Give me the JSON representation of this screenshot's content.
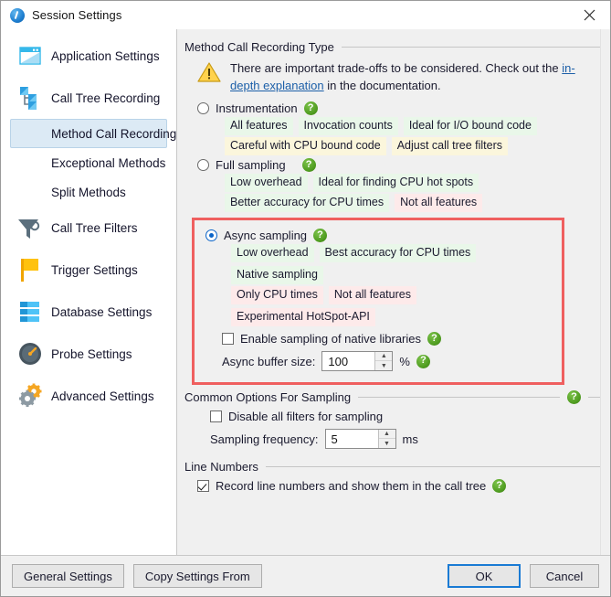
{
  "window": {
    "title": "Session Settings",
    "close_label": "✕",
    "icon": "session-settings-icon"
  },
  "sidebar": {
    "items": [
      {
        "label": "Application Settings",
        "icon": "window-icon",
        "selected": false,
        "has_icon": true
      },
      {
        "label": "Call Tree Recording",
        "icon": "call-tree-icon",
        "selected": false,
        "has_icon": true
      },
      {
        "label": "Method Call Recording",
        "icon": "none",
        "selected": true,
        "has_icon": false
      },
      {
        "label": "Exceptional Methods",
        "icon": "none",
        "selected": false,
        "has_icon": false
      },
      {
        "label": "Split Methods",
        "icon": "none",
        "selected": false,
        "has_icon": false
      },
      {
        "label": "Call Tree Filters",
        "icon": "funnel-icon",
        "selected": false,
        "has_icon": true
      },
      {
        "label": "Trigger Settings",
        "icon": "flag-icon",
        "selected": false,
        "has_icon": true
      },
      {
        "label": "Database Settings",
        "icon": "database-icon",
        "selected": false,
        "has_icon": true
      },
      {
        "label": "Probe Settings",
        "icon": "gauge-icon",
        "selected": false,
        "has_icon": true
      },
      {
        "label": "Advanced Settings",
        "icon": "gears-icon",
        "selected": false,
        "has_icon": true
      }
    ]
  },
  "main": {
    "recording_type": {
      "title": "Method Call Recording Type",
      "warning": {
        "text_before": "There are important trade-offs to be considered. Check out the ",
        "link_text": "in-depth explanation",
        "text_after": " in the documentation.",
        "icon": "warning-icon"
      },
      "options": [
        {
          "label": "Instrumentation",
          "selected": false,
          "help": "?",
          "tag_rows": [
            [
              {
                "text": "All features",
                "color": "green"
              },
              {
                "text": "Invocation counts",
                "color": "green"
              },
              {
                "text": "Ideal for I/O bound code",
                "color": "green"
              }
            ],
            [
              {
                "text": "Careful with CPU bound code",
                "color": "yellow"
              },
              {
                "text": "Adjust call tree filters",
                "color": "yellow"
              }
            ]
          ]
        },
        {
          "label": "Full sampling",
          "selected": false,
          "help": "?",
          "tag_rows": [
            [
              {
                "text": "Low overhead",
                "color": "green"
              },
              {
                "text": "Ideal for finding CPU hot spots",
                "color": "green"
              }
            ],
            [
              {
                "text": "Better accuracy for CPU times",
                "color": "green"
              },
              {
                "text": "Not all features",
                "color": "red"
              }
            ]
          ]
        }
      ],
      "async_option": {
        "label": "Async sampling",
        "selected": true,
        "help": "?",
        "highlight_color": "#ef5f5f",
        "tag_rows": [
          [
            {
              "text": "Low overhead",
              "color": "green"
            },
            {
              "text": "Best accuracy for CPU times",
              "color": "green"
            },
            {
              "text": "Native sampling",
              "color": "green"
            }
          ],
          [
            {
              "text": "Only CPU times",
              "color": "red"
            },
            {
              "text": "Not all features",
              "color": "red"
            },
            {
              "text": "Experimental HotSpot-API",
              "color": "red"
            }
          ]
        ],
        "native_checkbox": {
          "label": "Enable sampling of native libraries",
          "checked": false,
          "help": "?"
        },
        "buffer_field": {
          "label": "Async buffer size:",
          "value": "100",
          "unit": "%",
          "help": "?"
        }
      }
    },
    "common_options": {
      "title": "Common Options For Sampling",
      "help": "?",
      "disable_filters": {
        "label": "Disable all filters for sampling",
        "checked": false
      },
      "frequency_field": {
        "label": "Sampling frequency:",
        "value": "5",
        "unit": "ms"
      }
    },
    "line_numbers": {
      "title": "Line Numbers",
      "record_checkbox": {
        "label": "Record line numbers and show them in the call tree",
        "checked": true,
        "help": "?"
      }
    }
  },
  "footer": {
    "general_settings": "General Settings",
    "copy_settings_from": "Copy Settings From",
    "ok": "OK",
    "cancel": "Cancel"
  }
}
